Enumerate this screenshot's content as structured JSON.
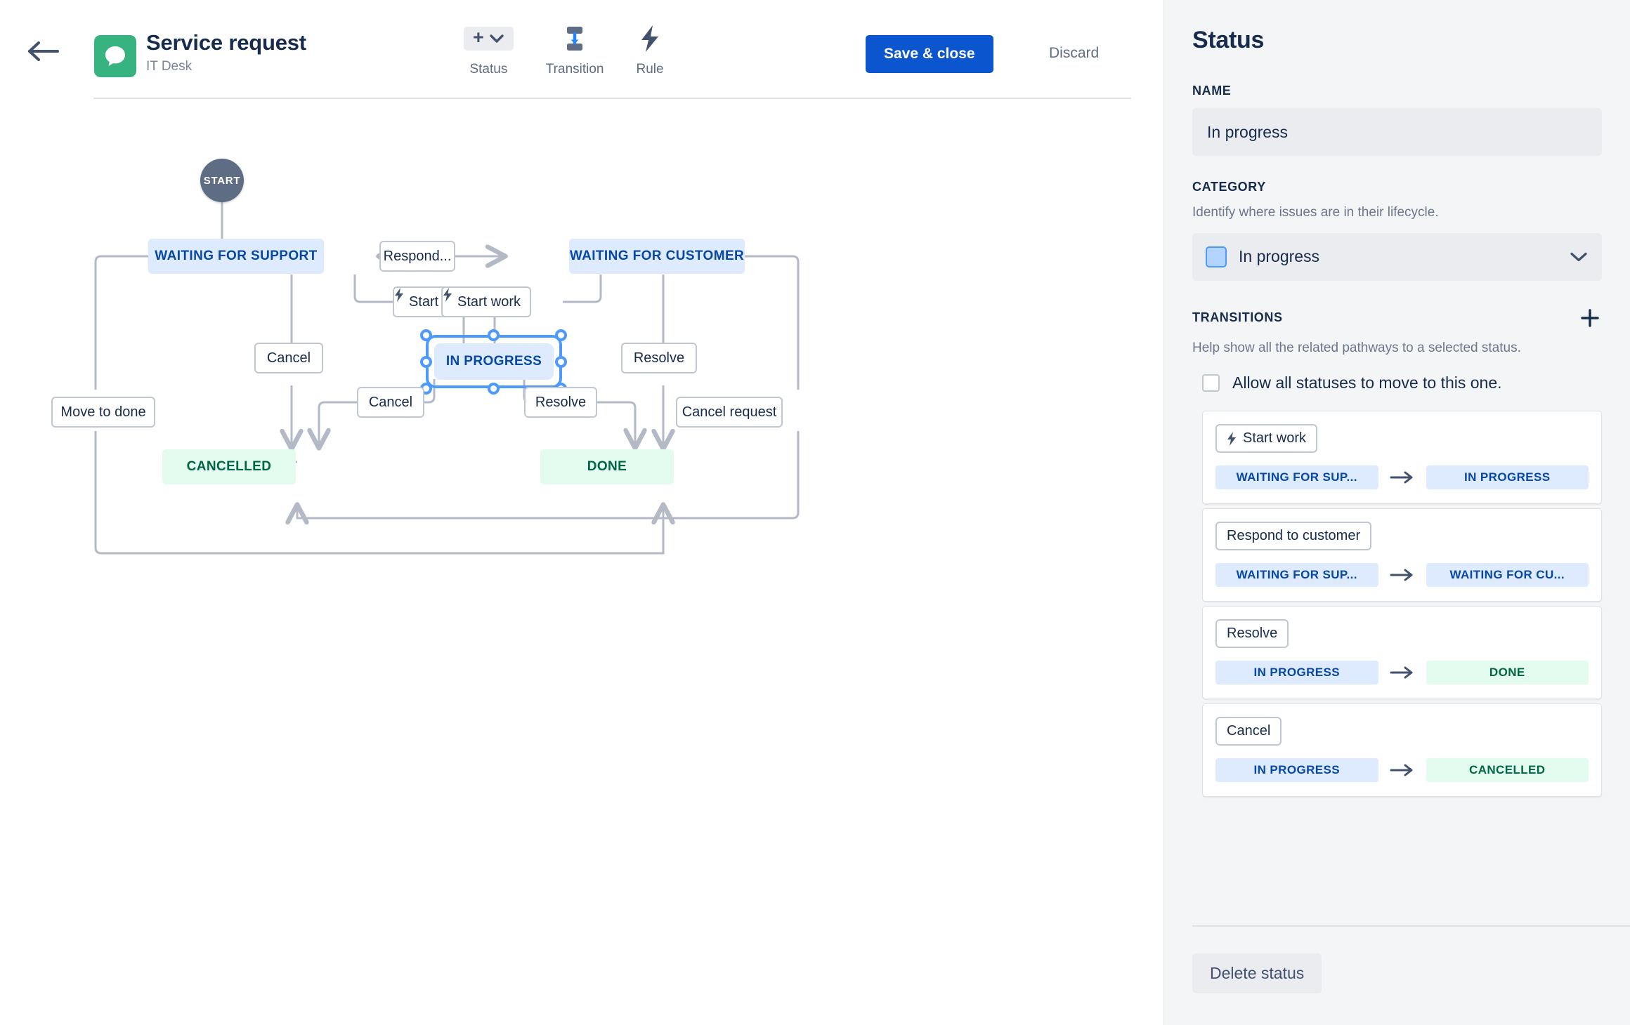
{
  "header": {
    "back_icon": "arrow-left-icon",
    "app_icon": "service-desk-speech-bubble-icon",
    "title": "Service request",
    "subtitle": "IT Desk",
    "tools": [
      {
        "icon": "plus-chevron-icon",
        "label": "Status"
      },
      {
        "icon": "transition-arrow-icon",
        "label": "Transition"
      },
      {
        "icon": "lightning-bolt-icon",
        "label": "Rule"
      }
    ],
    "save_label": "Save & close",
    "discard_label": "Discard",
    "accent_blue": "#0B55CE"
  },
  "diagram": {
    "start_label": "START",
    "nodes": [
      {
        "id": "wfs",
        "label": "WAITING FOR SUPPORT",
        "category": "blue"
      },
      {
        "id": "wfc",
        "label": "WAITING FOR CUSTOMER",
        "category": "blue"
      },
      {
        "id": "inprog",
        "label": "IN PROGRESS",
        "category": "blue",
        "selected": true
      },
      {
        "id": "cancelled",
        "label": "CANCELLED",
        "category": "green"
      },
      {
        "id": "done",
        "label": "DONE",
        "category": "green"
      }
    ],
    "edge_labels": [
      {
        "id": "respond",
        "text": "Respond...",
        "icon": null
      },
      {
        "id": "startwork-left",
        "text": "Start work",
        "icon": "lightning-bolt-icon"
      },
      {
        "id": "startwork-right",
        "text": "Start work",
        "icon": "lightning-bolt-icon"
      },
      {
        "id": "cancel-wfs",
        "text": "Cancel",
        "icon": null
      },
      {
        "id": "resolve-wfc",
        "text": "Resolve",
        "icon": null
      },
      {
        "id": "move-to-done",
        "text": "Move to done",
        "icon": null
      },
      {
        "id": "cancel-inprog",
        "text": "Cancel",
        "icon": null
      },
      {
        "id": "resolve-inprog",
        "text": "Resolve",
        "icon": null
      },
      {
        "id": "cancel-request",
        "text": "Cancel request",
        "icon": null
      }
    ],
    "colors": {
      "blue_node_bg": "#DEEBFF",
      "blue_node_text": "#0747A6",
      "green_node_bg": "#E3FCEF",
      "green_node_text": "#006644",
      "start_node_bg": "#5E6C84",
      "edge_line": "#B3BAC5",
      "selection": "#4C9AFF"
    }
  },
  "panel": {
    "title": "Status",
    "name_label": "NAME",
    "name_value": "In progress",
    "category_label": "CATEGORY",
    "category_help": "Identify where issues are in their lifecycle.",
    "category_value": "In progress",
    "category_swatch_color": "#B3D4FF",
    "chevron_icon": "chevron-down-icon",
    "transitions_label": "TRANSITIONS",
    "transitions_add_icon": "plus-icon",
    "transitions_help": "Help show all the related pathways to a selected status.",
    "allow_all_label": "Allow all statuses to move to this one.",
    "allow_all_checked": false,
    "transitions": [
      {
        "name": "Start work",
        "icon": "lightning-bolt-icon",
        "from": "WAITING FOR SUP...",
        "from_category": "blue",
        "to": "IN PROGRESS",
        "to_category": "blue"
      },
      {
        "name": "Respond to customer",
        "icon": null,
        "from": "WAITING FOR SUP...",
        "from_category": "blue",
        "to": "WAITING FOR CU...",
        "to_category": "blue"
      },
      {
        "name": "Resolve",
        "icon": null,
        "from": "IN PROGRESS",
        "from_category": "blue",
        "to": "DONE",
        "to_category": "green"
      },
      {
        "name": "Cancel",
        "icon": null,
        "from": "IN PROGRESS",
        "from_category": "blue",
        "to": "CANCELLED",
        "to_category": "green"
      }
    ],
    "delete_label": "Delete status"
  }
}
